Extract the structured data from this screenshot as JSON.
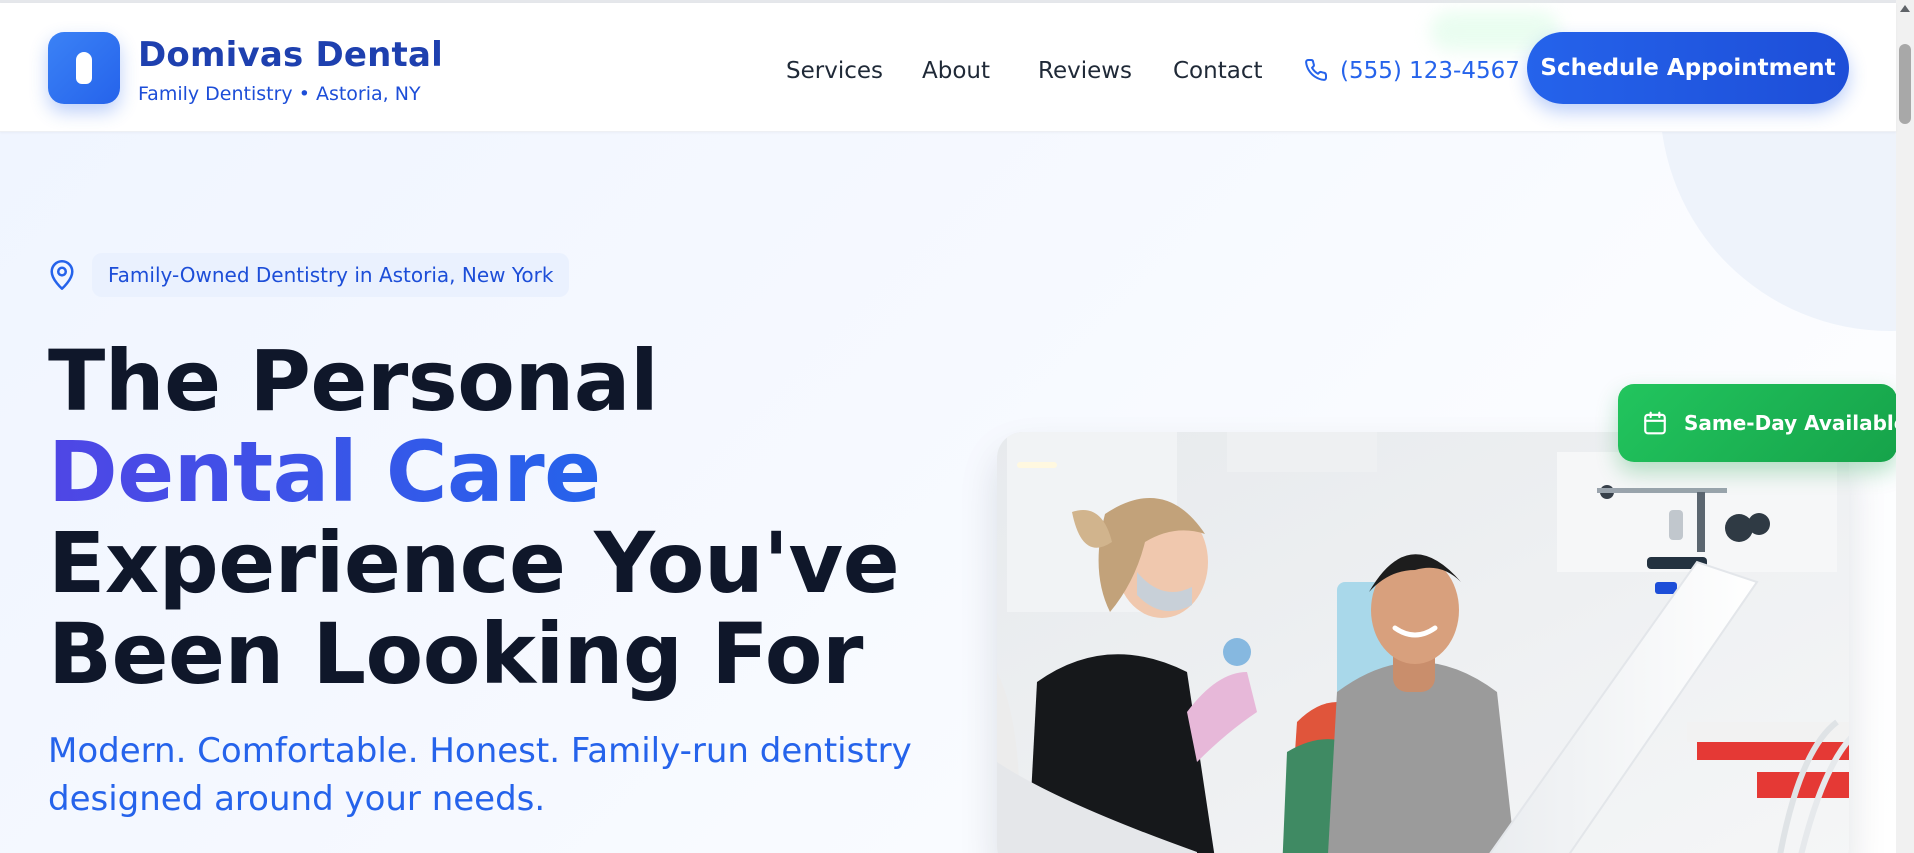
{
  "header": {
    "brand_name": "Domivas Dental",
    "brand_tagline": "Family Dentistry • Astoria, NY",
    "nav": [
      {
        "label": "Services"
      },
      {
        "label": "About"
      },
      {
        "label": "Reviews"
      },
      {
        "label": "Contact"
      }
    ],
    "phone": "(555) 123-4567",
    "cta_label": "Schedule Appointment",
    "icons": {
      "logo": "tooth-icon",
      "phone": "phone-icon"
    }
  },
  "hero": {
    "badge_text": "Family-Owned Dentistry in Astoria, New York",
    "badge_icon": "map-pin-icon",
    "headline_part1": "The Personal ",
    "headline_accent": "Dental Care",
    "headline_part2": " Experience You've Been Looking For",
    "subheadline": "Modern. Comfortable. Honest. Family-run dentistry designed around your needs.",
    "availability_badge": "Same-Day Available",
    "availability_icon": "calendar-icon",
    "photo_subject": "dentist-with-smiling-patient-photo"
  },
  "colors": {
    "brand_blue": "#2563eb",
    "brand_dark_blue": "#1e40af",
    "accent_indigo": "#4f46e5",
    "success_green": "#22c55e",
    "text_dark": "#0f172a"
  }
}
